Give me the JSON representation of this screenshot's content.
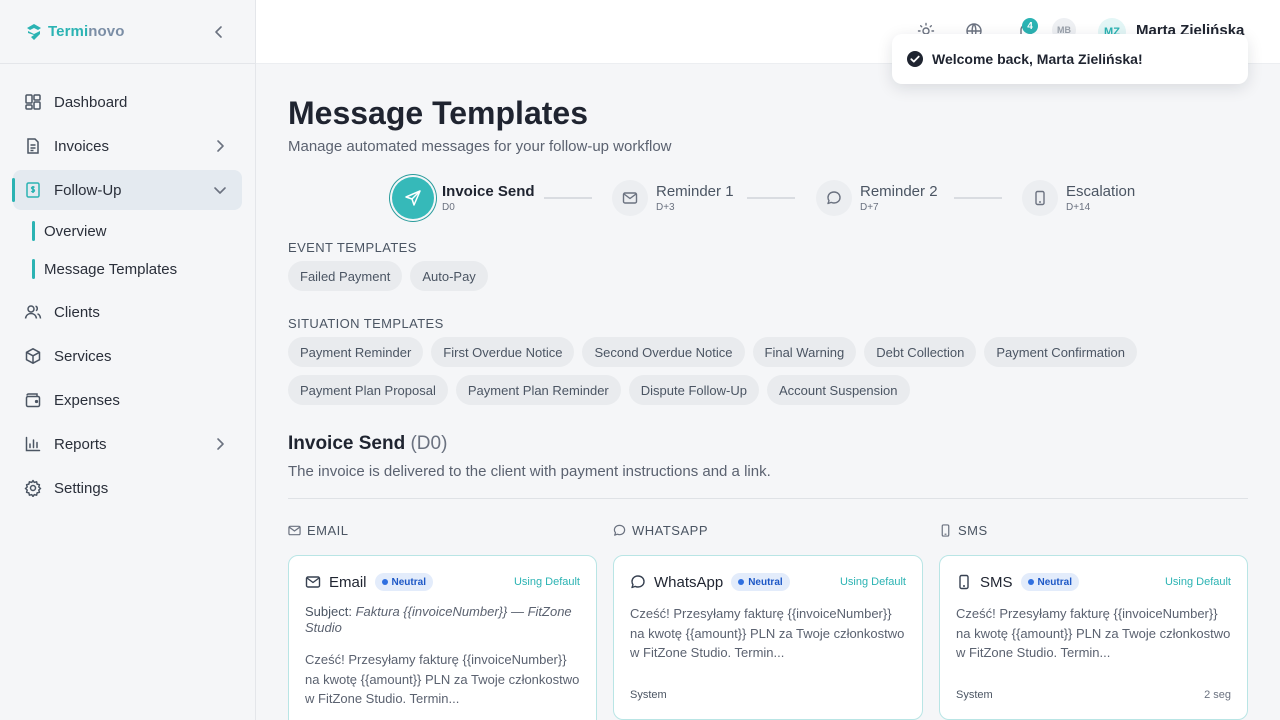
{
  "brand": {
    "name_part1": "Termi",
    "name_part2": "novo"
  },
  "sidebar": {
    "items": [
      {
        "label": "Dashboard"
      },
      {
        "label": "Invoices"
      },
      {
        "label": "Follow-Up"
      },
      {
        "label": "Clients"
      },
      {
        "label": "Services"
      },
      {
        "label": "Expenses"
      },
      {
        "label": "Reports"
      },
      {
        "label": "Settings"
      }
    ],
    "followup_sub": [
      {
        "label": "Overview"
      },
      {
        "label": "Message Templates"
      }
    ]
  },
  "topbar": {
    "notification_count": "4",
    "secondary_avatar": "MB",
    "user_initials": "MZ",
    "user_name": "Marta Zielińska"
  },
  "toast": {
    "message": "Welcome back, Marta Zielińska!"
  },
  "page": {
    "title": "Message Templates",
    "subtitle": "Manage automated messages for your follow-up workflow"
  },
  "workflow_steps": [
    {
      "label": "Invoice Send",
      "day": "D0",
      "icon": "send-icon",
      "current": true
    },
    {
      "label": "Reminder 1",
      "day": "D+3",
      "icon": "mail-icon"
    },
    {
      "label": "Reminder 2",
      "day": "D+7",
      "icon": "chat-bubble-icon"
    },
    {
      "label": "Escalation",
      "day": "D+14",
      "icon": "phone-icon"
    }
  ],
  "event_templates": {
    "label": "EVENT TEMPLATES",
    "items": [
      "Failed Payment",
      "Auto-Pay"
    ]
  },
  "situation_templates": {
    "label": "SITUATION TEMPLATES",
    "items": [
      "Payment Reminder",
      "First Overdue Notice",
      "Second Overdue Notice",
      "Final Warning",
      "Debt Collection",
      "Payment Confirmation",
      "Payment Plan Proposal",
      "Payment Plan Reminder",
      "Dispute Follow-Up",
      "Account Suspension"
    ]
  },
  "detail": {
    "title": "Invoice Send",
    "code": "(D0)",
    "description": "The invoice is delivered to the client with payment instructions and a link."
  },
  "channels": {
    "email": {
      "header": "EMAIL",
      "title": "Email",
      "badge": "Neutral",
      "status": "Using Default",
      "subject_label": "Subject:",
      "subject": "Faktura {{invoiceNumber}} — FitZone Studio",
      "body": "Cześć! Przesyłamy fakturę {{invoiceNumber}} na kwotę {{amount}} PLN za Twoje członkostwo w FitZone Studio. Termin..."
    },
    "whatsapp": {
      "header": "WHATSAPP",
      "title": "WhatsApp",
      "badge": "Neutral",
      "status": "Using Default",
      "body": "Cześć! Przesyłamy fakturę {{invoiceNumber}} na kwotę {{amount}} PLN za Twoje członkostwo w FitZone Studio. Termin...",
      "footer": "System"
    },
    "sms": {
      "header": "SMS",
      "title": "SMS",
      "badge": "Neutral",
      "status": "Using Default",
      "body": "Cześć! Przesyłamy fakturę {{invoiceNumber}} na kwotę {{amount}} PLN za Twoje członkostwo w FitZone Studio. Termin...",
      "footer": "System",
      "segments": "2 seg"
    }
  },
  "colors": {
    "accent": "#2bb3b3",
    "badge_bg": "#e3ecfb",
    "badge_text": "#1e58c6"
  }
}
